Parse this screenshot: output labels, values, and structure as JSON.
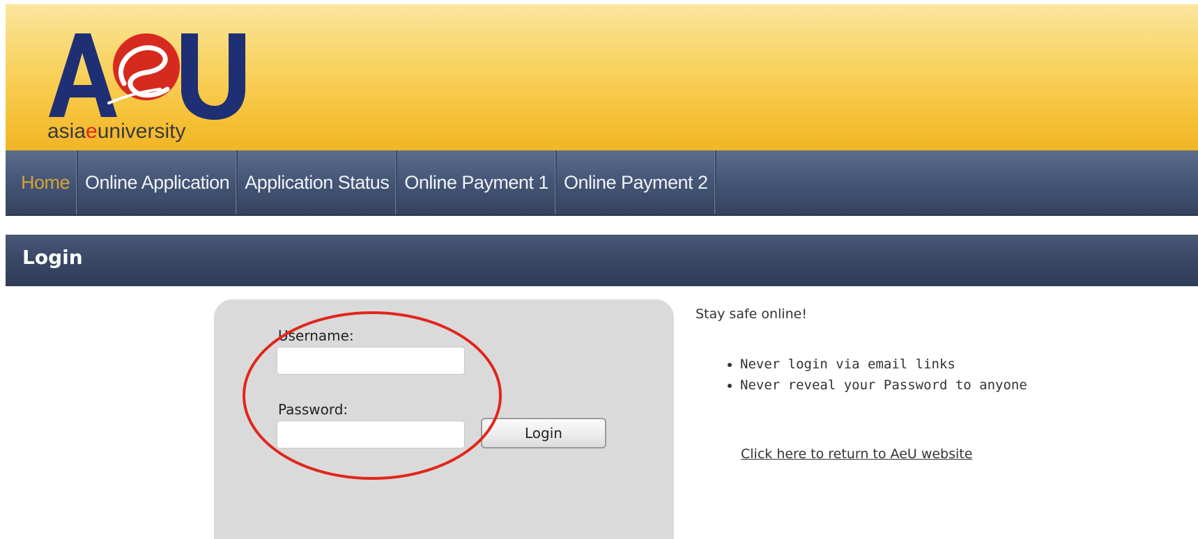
{
  "header": {
    "logo_letters": "AeU",
    "logo_tagline": "asiaeuniversity"
  },
  "nav": {
    "items": [
      {
        "label": "Home",
        "active": true
      },
      {
        "label": "Online Application",
        "active": false
      },
      {
        "label": "Application Status",
        "active": false
      },
      {
        "label": "Online Payment 1",
        "active": false
      },
      {
        "label": "Online Payment 2",
        "active": false
      }
    ]
  },
  "page_title": "Login",
  "login": {
    "username_label": "Username:",
    "username_value": "",
    "password_label": "Password:",
    "password_value": "",
    "submit_label": "Login"
  },
  "safety": {
    "title": "Stay safe online!",
    "tips": [
      "Never login via email links",
      "Never reveal your Password to anyone"
    ],
    "return_link": "Click here to return to AeU website"
  },
  "colors": {
    "header_gold": "#f6c23a",
    "nav_navy": "#48597a",
    "logo_navy": "#1f2f74",
    "logo_red": "#d72a1e",
    "annotation_red": "#e0261c"
  },
  "icons": {
    "annotation": "red-ellipse-highlight",
    "bullet": "disc"
  }
}
